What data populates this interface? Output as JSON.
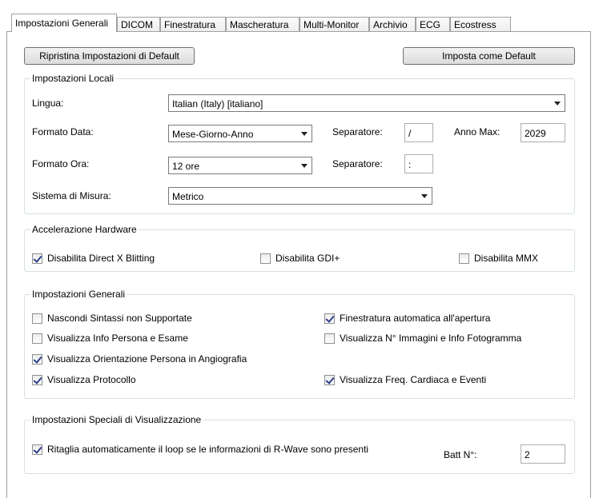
{
  "tabs": [
    "Impostazioni Generali",
    "DICOM",
    "Finestratura",
    "Mascheratura",
    "Multi-Monitor",
    "Archivio",
    "ECG",
    "Ecostress"
  ],
  "buttons": {
    "restore_default": "Ripristina Impostazioni di Default",
    "set_default": "Imposta come Default"
  },
  "local_settings": {
    "title": "Impostazioni Locali",
    "language_label": "Lingua:",
    "language_value": "Italian (Italy)    [italiano]",
    "date_format_label": "Formato Data:",
    "date_format_value": "Mese-Giorno-Anno",
    "date_separator_label": "Separatore:",
    "date_separator_value": "/",
    "max_year_label": "Anno Max:",
    "max_year_value": "2029",
    "time_format_label": "Formato Ora:",
    "time_format_value": "12 ore",
    "time_separator_label": "Separatore:",
    "time_separator_value": ":",
    "measure_label": "Sistema di Misura:",
    "measure_value": "Metrico"
  },
  "hw_acceleration": {
    "title": "Accelerazione Hardware",
    "items": [
      {
        "label": "Disabilita Direct X Blitting",
        "checked": true
      },
      {
        "label": "Disabilita GDI+",
        "checked": false
      },
      {
        "label": "Disabilita MMX",
        "checked": false
      }
    ]
  },
  "general_settings": {
    "title": "Impostazioni Generali",
    "items": [
      {
        "label": "Nascondi Sintassi non Supportate",
        "checked": false
      },
      {
        "label": "Finestratura automatica all'apertura",
        "checked": true
      },
      {
        "label": "Visualizza Info Persona e Esame",
        "checked": false
      },
      {
        "label": "Visualizza N° Immagini e Info Fotogramma",
        "checked": false
      },
      {
        "label": "Visualizza Orientazione Persona in Angiografia",
        "checked": true
      },
      {
        "label": "Visualizza Protocollo",
        "checked": true
      },
      {
        "label": "Visualizza Freq. Cardiaca e Eventi",
        "checked": true
      }
    ]
  },
  "special_display": {
    "title": "Impostazioni Speciali di Visualizzazione",
    "autocrop_label": "Ritaglia automaticamente il loop se le informazioni di R-Wave sono presenti",
    "autocrop_checked": true,
    "beats_label": "Batt N°:",
    "beats_value": "2"
  }
}
